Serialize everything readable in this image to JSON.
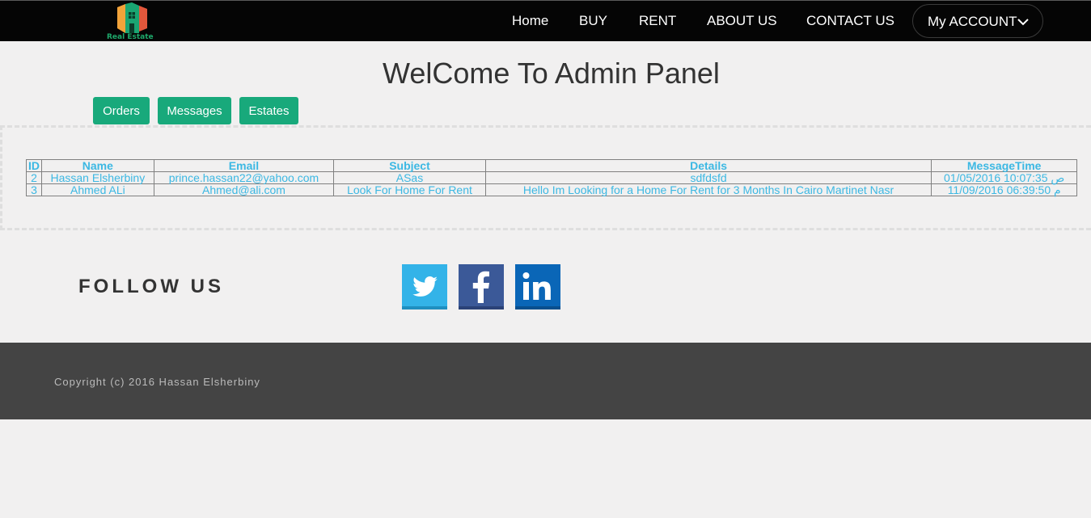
{
  "header": {
    "logo_text": "Real Estate",
    "nav": [
      "Home",
      "BUY",
      "RENT",
      "ABOUT US",
      "CONTACT US"
    ],
    "account_label": "My ACCOUNT"
  },
  "main": {
    "title": "WelCome To Admin Panel",
    "tabs": [
      "Orders",
      "Messages",
      "Estates"
    ],
    "table": {
      "columns": [
        "ID",
        "Name",
        "Email",
        "Subject",
        "Details",
        "MessageTime"
      ],
      "rows": [
        [
          "2",
          "Hassan Elsherbiny",
          "prince.hassan22@yahoo.com",
          "ASas",
          "sdfdsfd",
          "01/05/2016 10:07:35 ص"
        ],
        [
          "3",
          "Ahmed ALi",
          "Ahmed@ali.com",
          "Look For Home For Rent",
          "Hello Im Looking for a Home For Rent for 3 Months In Cairo Martinet Nasr",
          "11/09/2016 06:39:50 م"
        ]
      ]
    }
  },
  "follow": {
    "label": "FOLLOW US",
    "icons": [
      "twitter-icon",
      "facebook-icon",
      "linkedin-icon"
    ]
  },
  "footer": {
    "copyright": "Copyright (c) 2016 Hassan Elsherbiny"
  },
  "colors": {
    "accent": "#18a97b",
    "link": "#3cb8e3",
    "header_bg": "#050505",
    "footer_bg": "#444444",
    "twitter": "#33b3e8",
    "facebook": "#3b5998",
    "linkedin": "#0a66b7"
  }
}
